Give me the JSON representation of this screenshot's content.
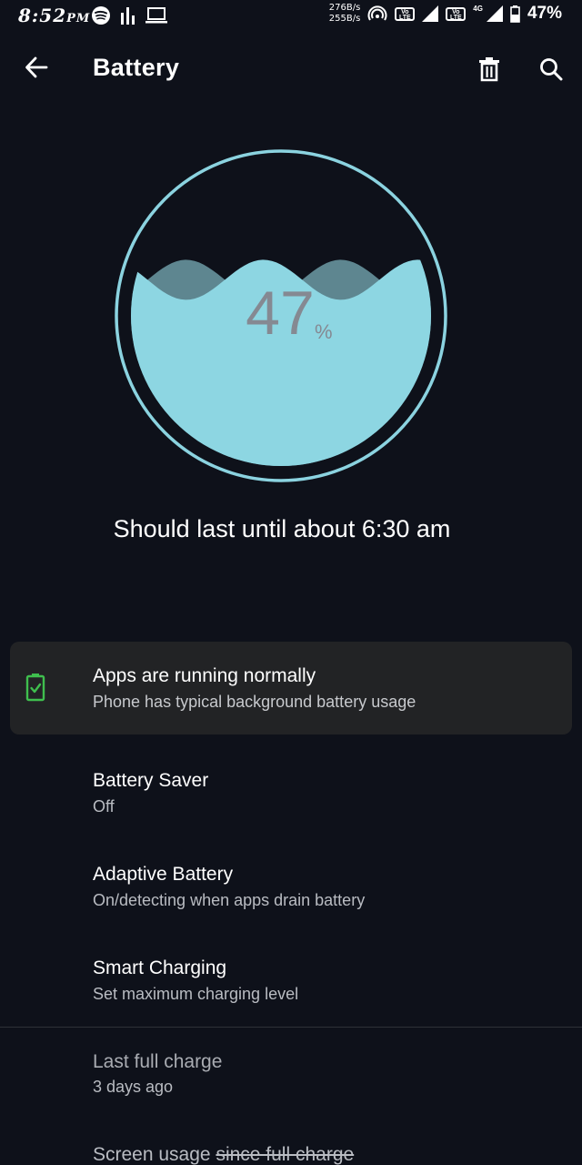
{
  "status_bar": {
    "time": "8:52",
    "ampm": "PM",
    "net_up": "276B/s",
    "net_down": "255B/s",
    "volte_label": "Vo LTE",
    "network_type": "4G",
    "battery_percent": "47%"
  },
  "app_bar": {
    "title": "Battery",
    "icons": [
      "arrow-back-icon",
      "trash-icon",
      "search-icon"
    ]
  },
  "gauge": {
    "level": 47,
    "value_text": "47",
    "unit_text": "%",
    "ring_color": "#8bd3e0",
    "fill_color": "#8dd6e2",
    "back_wave_color": "#5e8690"
  },
  "estimate": "Should last until about 6:30 am",
  "status_card": {
    "title": "Apps are running normally",
    "subtitle": "Phone has typical background battery usage",
    "icon": "battery-check-icon",
    "icon_color": "#3fbf4e"
  },
  "preferences": [
    {
      "title": "Battery Saver",
      "subtitle": "Off"
    },
    {
      "title": "Adaptive Battery",
      "subtitle": "On/detecting when apps drain battery"
    },
    {
      "title": "Smart Charging",
      "subtitle": "Set maximum charging level"
    }
  ],
  "info": {
    "last_charge_title": "Last full charge",
    "last_charge_value": "3 days ago",
    "screen_usage_prefix": "Screen usage ",
    "screen_usage_struck": "since full charge"
  }
}
